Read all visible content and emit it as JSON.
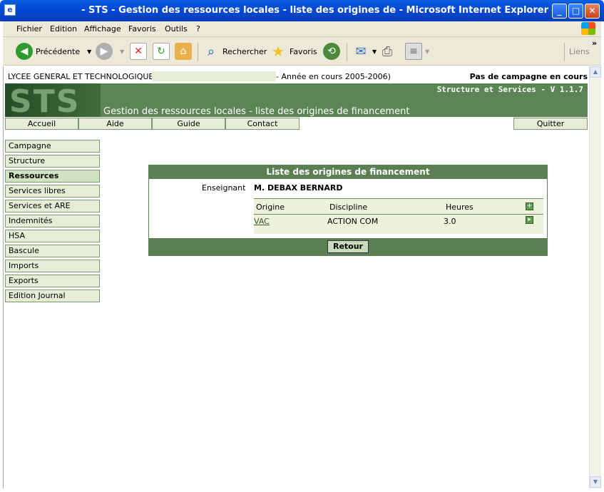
{
  "window": {
    "title": "- STS - Gestion des ressources locales - liste des origines de - Microsoft Internet Explorer",
    "app_icon": "ie-page-icon",
    "controls": [
      "minimize",
      "maximize",
      "close"
    ]
  },
  "menubar": {
    "items": [
      "Fichier",
      "Edition",
      "Affichage",
      "Favoris",
      "Outils",
      "?"
    ]
  },
  "toolbar": {
    "back_label": "Précédente",
    "search_label": "Rechercher",
    "favorites_label": "Favoris",
    "links_label": "Liens"
  },
  "header": {
    "etablissement": "LYCEE GENERAL ET TECHNOLOGIQUE",
    "annee": "- Année en cours 2005-2006)",
    "campagne": "Pas de campagne en cours"
  },
  "banner": {
    "logo_text": "STS",
    "version": "Structure et Services - V 1.1.7",
    "page_title": "Gestion des ressources locales - liste des origines de financement"
  },
  "topnav": {
    "items": [
      "Accueil",
      "Aide",
      "Guide",
      "Contact"
    ],
    "quit": "Quitter"
  },
  "sidenav": {
    "items": [
      "Campagne",
      "Structure",
      "Ressources",
      "Services libres",
      "Services et ARE",
      "Indemnités",
      "HSA",
      "Bascule",
      "Imports",
      "Exports",
      "Edition Journal"
    ],
    "active": "Ressources"
  },
  "panel": {
    "title": "Liste des origines de financement",
    "enseignant_label": "Enseignant",
    "enseignant_value": "M. DEBAX BERNARD",
    "columns": [
      "Origine",
      "Discipline",
      "Heures"
    ],
    "rows": [
      {
        "origine": "VAC",
        "discipline": "ACTION COM",
        "heures": "3.0"
      }
    ],
    "retour_label": "Retour"
  },
  "colors": {
    "brand_green": "#5b7f52",
    "nav_bg": "#e6edd6",
    "xp_blue": "#0349d6"
  }
}
